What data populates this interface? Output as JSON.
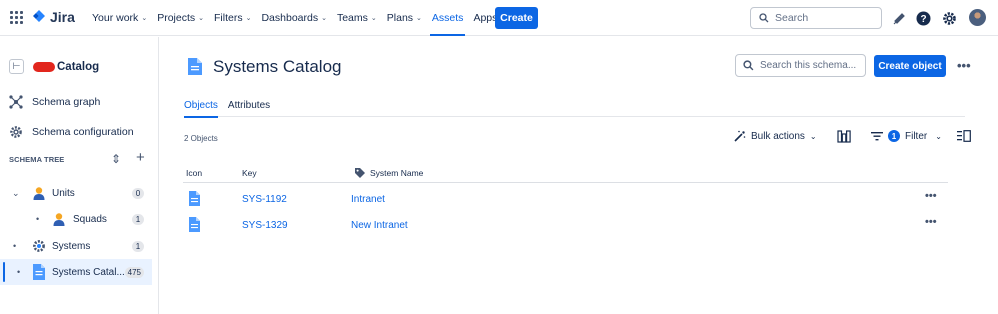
{
  "topnav": {
    "brand": "Jira",
    "items": [
      {
        "label": "Your work",
        "chevron": true
      },
      {
        "label": "Projects",
        "chevron": true
      },
      {
        "label": "Filters",
        "chevron": true
      },
      {
        "label": "Dashboards",
        "chevron": true
      },
      {
        "label": "Teams",
        "chevron": true
      },
      {
        "label": "Plans",
        "chevron": true
      },
      {
        "label": "Assets",
        "chevron": false,
        "active": true
      },
      {
        "label": "Apps",
        "chevron": true
      }
    ],
    "create_label": "Create",
    "search_placeholder": "Search",
    "accent": "#0c66e4"
  },
  "sidebar": {
    "project_name": "Catalog",
    "links": [
      {
        "label": "Schema graph",
        "icon": "schema-graph-icon"
      },
      {
        "label": "Schema configuration",
        "icon": "gear-icon"
      }
    ],
    "tree_heading": "SCHEMA TREE",
    "tree": [
      {
        "label": "Units",
        "count": "0",
        "level": 0,
        "expanded": true,
        "icon": "person-icon"
      },
      {
        "label": "Squads",
        "count": "1",
        "level": 1,
        "icon": "person-icon"
      },
      {
        "label": "Systems",
        "count": "1",
        "level": 0,
        "icon": "cog-icon"
      },
      {
        "label": "Systems Catal...",
        "count": "475",
        "level": 0,
        "selected": true,
        "icon": "document-icon"
      }
    ]
  },
  "main": {
    "title": "Systems Catalog",
    "search_placeholder": "Search this schema...",
    "create_object_label": "Create object",
    "tabs": [
      {
        "label": "Objects",
        "active": true
      },
      {
        "label": "Attributes",
        "active": false
      }
    ],
    "object_count": "2 Objects",
    "bulk_actions_label": "Bulk actions",
    "filter_count": "1",
    "filter_label": "Filter",
    "columns": {
      "icon": "Icon",
      "key": "Key",
      "name": "System Name"
    },
    "rows": [
      {
        "key": "SYS-1192",
        "name": "Intranet"
      },
      {
        "key": "SYS-1329",
        "name": "New Intranet"
      }
    ]
  }
}
